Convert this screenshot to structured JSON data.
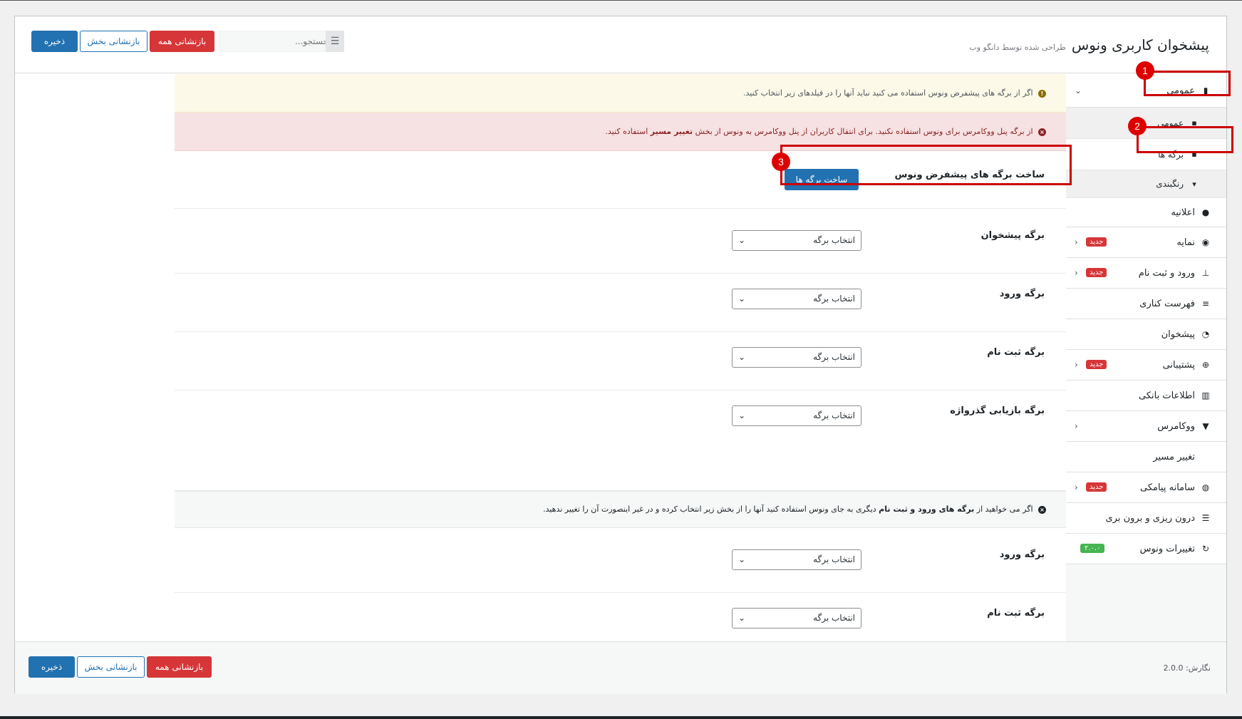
{
  "header": {
    "title": "پیشخوان کاربری ونوس",
    "subtitle": "طراحی شده توسط دانگو وب",
    "search_placeholder": "جستجو...",
    "save_label": "ذخیره",
    "reset_section_label": "بازنشانی بخش",
    "reset_all_label": "بازنشانی همه"
  },
  "sidebar": {
    "items": [
      {
        "label": "عمومی",
        "icon": "bookmark-icon"
      },
      {
        "label": "رنگبندی",
        "icon": "paint-roller-icon"
      },
      {
        "label": "اعلانیه",
        "icon": "bell-icon"
      },
      {
        "label": "نمایه",
        "icon": "user-circle-icon",
        "badge": "جدید"
      },
      {
        "label": "ورود و ثبت نام",
        "icon": "signpost-icon",
        "badge": "جدید"
      },
      {
        "label": "فهرست کناری",
        "icon": "list-icon"
      },
      {
        "label": "پیشخوان",
        "icon": "dashboard-icon"
      },
      {
        "label": "پشتیبانی",
        "icon": "lifebuoy-icon",
        "badge": "جدید"
      },
      {
        "label": "اطلاعات بانکی",
        "icon": "bank-icon"
      },
      {
        "label": "ووکامرس",
        "icon": "cart-icon"
      },
      {
        "label": "تغییر مسیر",
        "icon": "route-icon"
      },
      {
        "label": "سامانه پیامکی",
        "icon": "chat-icon",
        "badge": "جدید"
      },
      {
        "label": "درون ریزی و برون بری",
        "icon": "database-icon"
      },
      {
        "label": "تغییرات ونوس",
        "icon": "refresh-icon",
        "version_badge": "۲.۰.۰"
      }
    ],
    "subitems": [
      {
        "label": "عمومی",
        "icon": "file-icon"
      },
      {
        "label": "برگه ها",
        "icon": "file-icon"
      }
    ]
  },
  "notices": {
    "yellow": "اگر از برگه های پیشفرض ونوس استفاده می کنید نباید آنها را در فیلدهای زیر انتخاب کنید.",
    "red_pre": "از برگه پنل ووکامرس برای ونوس استفاده نکنید. برای انتقال کاربران از پنل ووکامرس به ونوس از بخش",
    "red_bold": "تغییر مسیر",
    "red_post": "استفاده کنید.",
    "gray_pre": "اگر می خواهید از",
    "gray_bold": "برگه های ورود و ثبت نام",
    "gray_post": "دیگری به جای ونوس استفاده کنید آنها را از بخش زیر انتخاب کرده و در غیر اینصورت آن را تغییر ندهید."
  },
  "settings": {
    "make_pages_label": "ساخت برگه های پیشفرض ونوس",
    "make_pages_button": "ساخت برگه ها",
    "select_placeholder": "انتخاب برگه",
    "rows": [
      {
        "label": "برگه پیشخوان"
      },
      {
        "label": "برگه ورود"
      },
      {
        "label": "برگه ثبت نام"
      },
      {
        "label": "برگه بازیابی گذرواژه"
      }
    ],
    "rows2": [
      {
        "label": "برگه ورود"
      },
      {
        "label": "برگه ثبت نام"
      }
    ]
  },
  "annotations": [
    "1",
    "2",
    "3"
  ],
  "footer": {
    "version_label": "نگارش: 2.0.0"
  },
  "colors": {
    "primary": "#2271b1",
    "danger": "#d63638",
    "success": "#46b450",
    "annotation": "#cc0000"
  }
}
